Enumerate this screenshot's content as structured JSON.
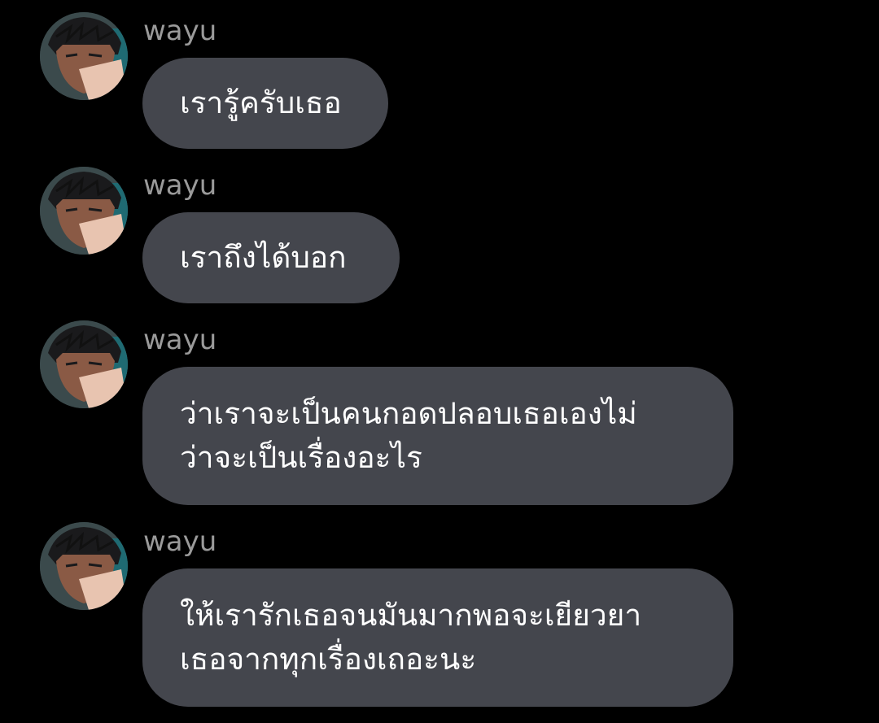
{
  "messages": [
    {
      "sender": "wayu",
      "text": "เรารู้ครับเธอ"
    },
    {
      "sender": "wayu",
      "text": "เราถึงได้บอก"
    },
    {
      "sender": "wayu",
      "text": "ว่าเราจะเป็นคนกอดปลอบเธอเองไม่\nว่าจะเป็นเรื่องอะไร"
    },
    {
      "sender": "wayu",
      "text": "ให้เรารักเธอจนมันมากพอจะเยียวยา\nเธอจากทุกเรื่องเถอะนะ"
    }
  ],
  "colors": {
    "background": "#000000",
    "bubble": "#44464d",
    "sender_name": "#9a9a9a",
    "message_text": "#ffffff"
  },
  "icons": {
    "avatar": "anime-boy-avatar-icon"
  }
}
